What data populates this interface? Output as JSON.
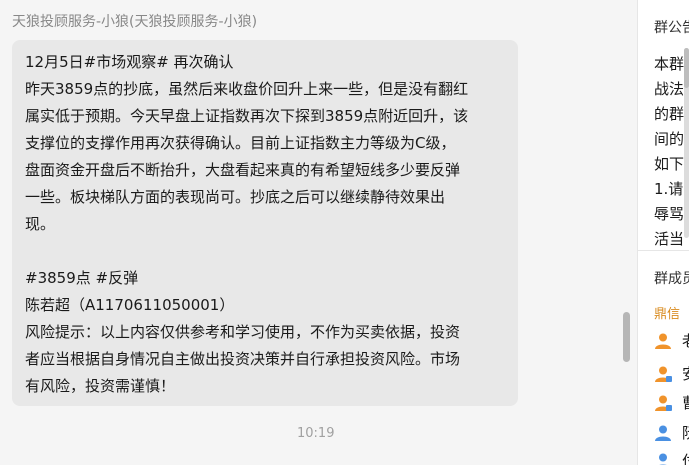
{
  "chat": {
    "sender": "天狼投顾服务-小狼(天狼投顾服务-小狼)",
    "message_lines": [
      "12月5日#市场观察# 再次确认",
      "昨天3859点的抄底，虽然后来收盘价回升上来一些，但是没有翻红",
      "属实低于预期。今天早盘上证指数再次下探到3859点附近回升，该",
      "支撑位的支撑作用再次获得确认。目前上证指数主力等级为C级，",
      "盘面资金开盘后不断抬升，大盘看起来真的有希望短线多少要反弹",
      "一些。板块梯队方面的表现尚可。抄底之后可以继续静待效果出",
      "现。",
      "",
      "#3859点   #反弹",
      "陈若超（A1170611050001）",
      "风险提示：以上内容仅供参考和学习使用，不作为买卖依据，投资",
      "者应当根据自身情况自主做出投资决策并自行承担投资风险。市场",
      "有风险，投资需谨慎！"
    ],
    "timestamp": "10:19"
  },
  "side": {
    "announcement_title": "群公告",
    "announcement_lines": [
      "本群为",
      "战法",
      "的群",
      "间的",
      "如下",
      "1.请",
      "辱骂",
      "活当"
    ],
    "members_title": "群成员",
    "group_name": "鼎信",
    "members": [
      {
        "name": "老",
        "avatar_color": "#f0932b"
      },
      {
        "name": "安",
        "avatar_color": "#f0932b"
      },
      {
        "name": "曹",
        "avatar_color": "#f0932b"
      },
      {
        "name": "阮",
        "avatar_color": "#4a90e2"
      },
      {
        "name": "付",
        "avatar_color": "#4a90e2"
      }
    ]
  }
}
